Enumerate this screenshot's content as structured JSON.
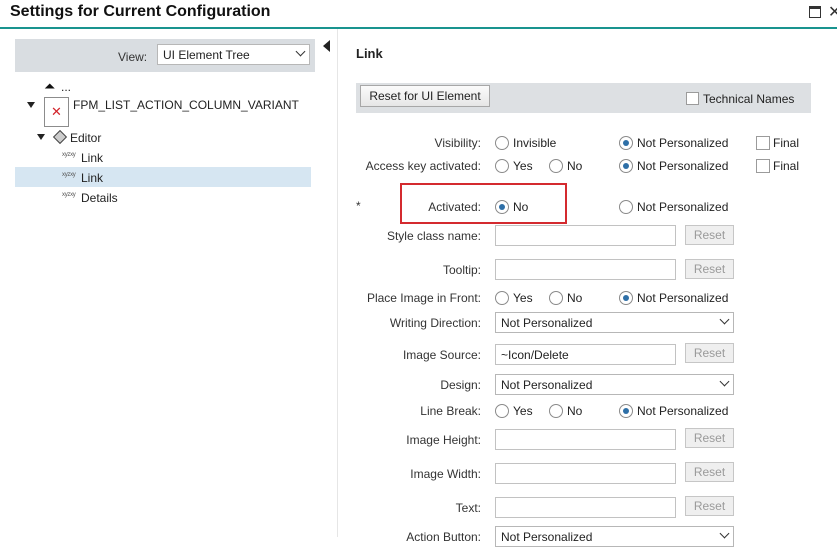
{
  "header": {
    "title": "Settings for Current Configuration"
  },
  "left": {
    "view_label": "View:",
    "view_value": "UI Element Tree",
    "tree": {
      "up_text": "...",
      "variant": "FPM_LIST_ACTION_COLUMN_VARIANT",
      "editor": "Editor",
      "items": [
        {
          "label": "Link"
        },
        {
          "label": "Link"
        },
        {
          "label": "Details"
        }
      ]
    }
  },
  "right": {
    "title": "Link",
    "reset_ui_element": "Reset for UI Element",
    "technical_names": "Technical Names",
    "required_mark": "*",
    "common": {
      "invisible": "Invisible",
      "yes": "Yes",
      "no": "No",
      "not_personalized": "Not Personalized",
      "final": "Final",
      "reset": "Reset"
    },
    "fields": {
      "visibility": {
        "label": "Visibility:",
        "selected": "Not Personalized"
      },
      "access_key": {
        "label": "Access key activated:",
        "selected": "Not Personalized"
      },
      "activated": {
        "label": "Activated:",
        "selected": "No"
      },
      "style_class": {
        "label": "Style class name:",
        "value": ""
      },
      "tooltip": {
        "label": "Tooltip:",
        "value": ""
      },
      "image_front": {
        "label": "Place Image in Front:",
        "selected": "Not Personalized"
      },
      "writing_direction": {
        "label": "Writing Direction:",
        "value": "Not Personalized"
      },
      "image_source": {
        "label": "Image Source:",
        "value": "~Icon/Delete"
      },
      "design": {
        "label": "Design:",
        "value": "Not Personalized"
      },
      "line_break": {
        "label": "Line Break:",
        "selected": "Not Personalized"
      },
      "image_height": {
        "label": "Image Height:",
        "value": ""
      },
      "image_width": {
        "label": "Image Width:",
        "value": ""
      },
      "text": {
        "label": "Text:",
        "value": ""
      },
      "action_button": {
        "label": "Action Button:",
        "value": "Not Personalized"
      }
    }
  }
}
